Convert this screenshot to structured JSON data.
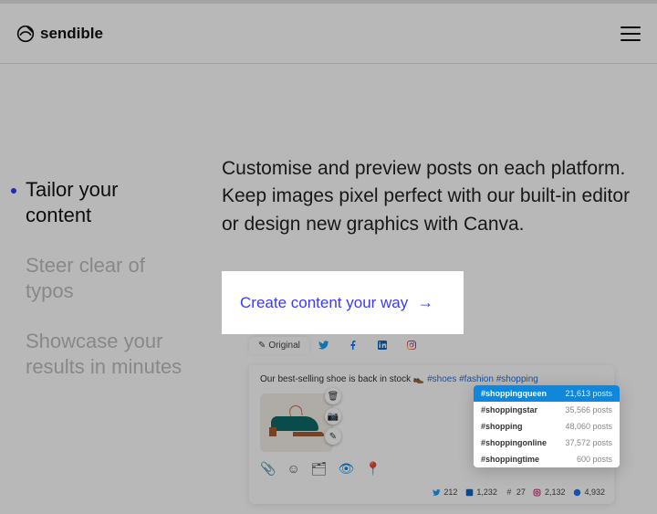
{
  "brand": {
    "name": "sendible"
  },
  "nav": {
    "items": [
      {
        "label": "Tailor your content",
        "active": true
      },
      {
        "label": "Steer clear of typos",
        "active": false
      },
      {
        "label": "Showcase your results in minutes",
        "active": false
      }
    ]
  },
  "blurb": "Customise and preview posts on each platform. Keep images pixel perfect with our built-in editor or design new graphics with Canva.",
  "cta": {
    "label": "Create content your way",
    "arrow": "→"
  },
  "composer": {
    "tabs": {
      "original": "Original",
      "networks": [
        "twitter",
        "facebook",
        "linkedin",
        "instagram"
      ]
    },
    "post": {
      "text": "Our best-selling shoe is back in stock 👞 ",
      "hashtags": [
        "#shoes",
        "#fashion",
        "#shopping"
      ]
    },
    "hashtag_suggestions": [
      {
        "tag": "#shoppingqueen",
        "count": "21,613 posts",
        "highlight": true
      },
      {
        "tag": "#shoppingstar",
        "count": "35,566 posts",
        "highlight": false
      },
      {
        "tag": "#shopping",
        "count": "48,060 posts",
        "highlight": false
      },
      {
        "tag": "#shoppingonline",
        "count": "37,572 posts",
        "highlight": false
      },
      {
        "tag": "#shoppingtime",
        "count": "600 posts",
        "highlight": false
      }
    ],
    "image_actions": {
      "delete": "🗑",
      "camera": "📷",
      "edit": "✎"
    },
    "toolbar": {
      "attach": "📎",
      "emoji": "☺",
      "library": "🗂",
      "preview": "👁",
      "location": "📍"
    },
    "footer_stats": [
      {
        "network": "twitter",
        "value": "212",
        "glyph": "tw"
      },
      {
        "network": "linkedin",
        "value": "1,232",
        "glyph": "li"
      },
      {
        "network": "hashtag",
        "value": "27",
        "glyph": "ht"
      },
      {
        "network": "instagram",
        "value": "2,132",
        "glyph": "ig"
      },
      {
        "network": "facebook",
        "value": "4,932",
        "glyph": "fb"
      }
    ]
  }
}
